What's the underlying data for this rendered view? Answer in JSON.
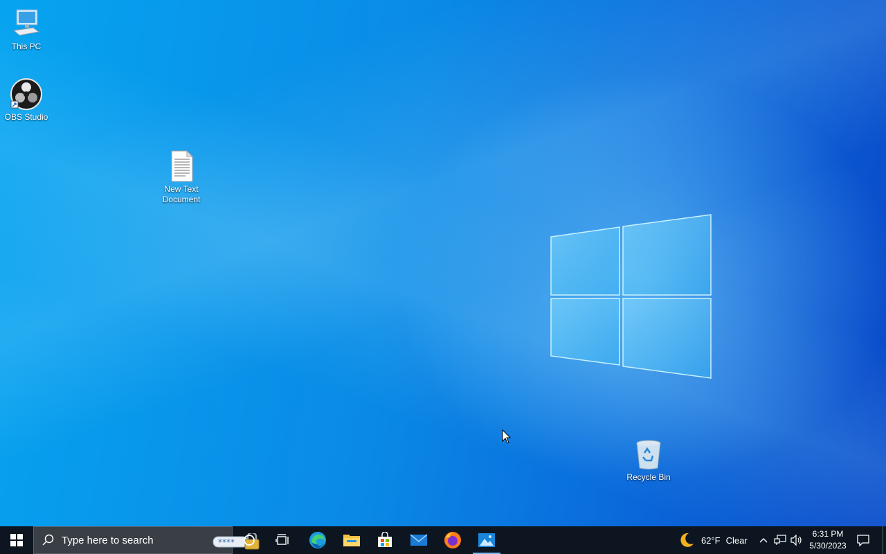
{
  "desktop": {
    "icons": [
      {
        "label": "This PC",
        "icon": "computer-icon"
      },
      {
        "label": "OBS Studio",
        "icon": "obs-icon"
      },
      {
        "label": "New Text Document",
        "icon": "text-document-icon"
      },
      {
        "label": "Recycle Bin",
        "icon": "recycle-bin-icon"
      }
    ]
  },
  "taskbar": {
    "start_icon": "windows-start-icon",
    "search": {
      "placeholder": "Type here to search",
      "icon": "search-icon"
    },
    "cortana_icon": "cortana-circle-icon",
    "task_view_icon": "task-view-icon",
    "pinned": [
      {
        "name": "Microsoft Edge",
        "icon": "edge-icon"
      },
      {
        "name": "File Explorer",
        "icon": "folder-icon"
      },
      {
        "name": "Microsoft Store",
        "icon": "store-icon"
      },
      {
        "name": "Mail",
        "icon": "mail-icon"
      },
      {
        "name": "Firefox",
        "icon": "firefox-icon"
      },
      {
        "name": "Photos",
        "icon": "photos-icon",
        "active": true
      }
    ],
    "weather": {
      "temp": "62°F",
      "condition": "Clear",
      "icon": "moon-icon"
    },
    "tray": {
      "chevron": "^",
      "network_icon": "network-icon",
      "volume_icon": "volume-icon"
    },
    "clock": {
      "time": "6:31 PM",
      "date": "5/30/2023"
    },
    "notification_icon": "notification-icon"
  },
  "colors": {
    "taskbar": "#0d1620",
    "desktop_accent": "#0a8ae6"
  }
}
